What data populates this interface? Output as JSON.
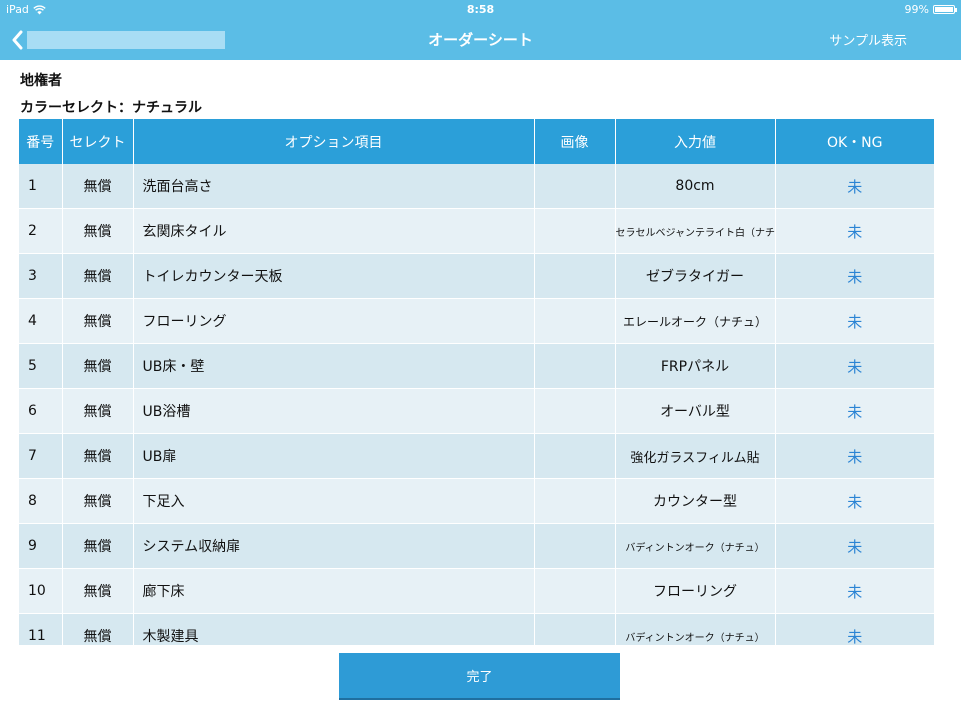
{
  "status_bar": {
    "carrier": "iPad",
    "time": "8:58",
    "battery": "99%"
  },
  "navbar": {
    "title": "オーダーシート",
    "right_action": "サンプル表示"
  },
  "info": {
    "line1": "地権者",
    "line2": "カラーセレクト：ナチュラル"
  },
  "table": {
    "headers": [
      "番号",
      "セレクト",
      "オプション項目",
      "画像",
      "入力値",
      "OK・NG"
    ],
    "rows": [
      {
        "no": "1",
        "select": "無償",
        "item": "洗面台高さ",
        "image": "",
        "value": "80cm",
        "status": "未"
      },
      {
        "no": "2",
        "select": "無償",
        "item": "玄関床タイル",
        "image": "",
        "value": "セラセルベジャンテライト白（ナチ",
        "status": "未"
      },
      {
        "no": "3",
        "select": "無償",
        "item": "トイレカウンター天板",
        "image": "",
        "value": "ゼブラタイガー",
        "status": "未"
      },
      {
        "no": "4",
        "select": "無償",
        "item": "フローリング",
        "image": "",
        "value": "エレールオーク（ナチュ）",
        "status": "未"
      },
      {
        "no": "5",
        "select": "無償",
        "item": "UB床・壁",
        "image": "",
        "value": "FRPパネル",
        "status": "未"
      },
      {
        "no": "6",
        "select": "無償",
        "item": "UB浴槽",
        "image": "",
        "value": "オーバル型",
        "status": "未"
      },
      {
        "no": "7",
        "select": "無償",
        "item": "UB扉",
        "image": "",
        "value": "強化ガラスフィルム貼",
        "status": "未"
      },
      {
        "no": "8",
        "select": "無償",
        "item": "下足入",
        "image": "",
        "value": "カウンター型",
        "status": "未"
      },
      {
        "no": "9",
        "select": "無償",
        "item": "システム収納扉",
        "image": "",
        "value": "バディントンオーク（ナチュ）",
        "status": "未"
      },
      {
        "no": "10",
        "select": "無償",
        "item": "廊下床",
        "image": "",
        "value": "フローリング",
        "status": "未"
      },
      {
        "no": "11",
        "select": "無償",
        "item": "木製建具",
        "image": "",
        "value": "バディントンオーク（ナチュ）",
        "status": "未"
      }
    ]
  },
  "footer": {
    "done_label": "完了"
  },
  "colors": {
    "navbar": "#5bbde6",
    "header": "#2b9fd9",
    "row_odd": "#d6e8f0",
    "row_even": "#e7f1f6",
    "status_link": "#2b84d4",
    "button": "#2e9bd6"
  },
  "icons": {
    "back": "chevron-left-icon",
    "wifi": "wifi-icon",
    "battery": "battery-icon"
  }
}
